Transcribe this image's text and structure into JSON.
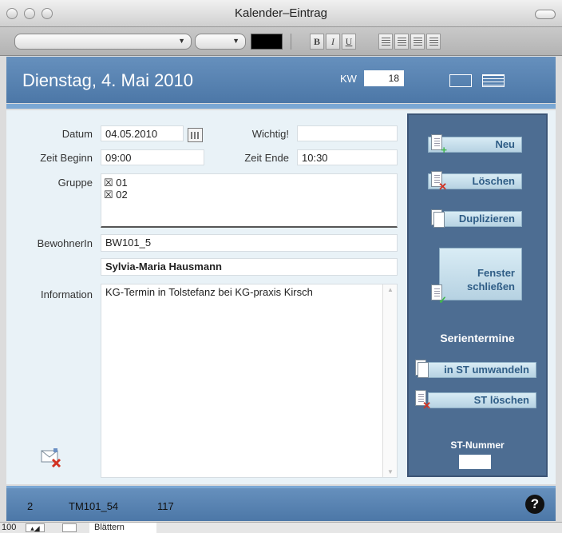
{
  "window": {
    "title": "Kalender–Eintrag"
  },
  "toolbar": {
    "bold_label": "B",
    "italic_label": "I",
    "underline_label": "U",
    "text_color": "#000000"
  },
  "header": {
    "date_title": "Dienstag, 4. Mai 2010",
    "kw_label": "KW",
    "kw_value": "18"
  },
  "form": {
    "datum_label": "Datum",
    "datum_value": "04.05.2010",
    "wichtig_label": "Wichtig!",
    "wichtig_value": "",
    "zeit_beginn_label": "Zeit Beginn",
    "zeit_beginn_value": "09:00",
    "zeit_ende_label": "Zeit Ende",
    "zeit_ende_value": "10:30",
    "gruppe_label": "Gruppe",
    "gruppe_items": [
      {
        "mark": "☒",
        "label": "01"
      },
      {
        "mark": "☒",
        "label": "02"
      }
    ],
    "bewohnerin_label": "BewohnerIn",
    "bewohnerin_id": "BW101_5",
    "bewohnerin_name": "Sylvia-Maria Hausmann",
    "information_label": "Information",
    "information_value": "KG-Termin in Tolstefanz bei KG-praxis Kirsch"
  },
  "side_panel": {
    "neu_label": "Neu",
    "loeschen_label": "Löschen",
    "duplizieren_label": "Duplizieren",
    "fenster_line1": "Fenster",
    "fenster_line2": "schließen",
    "serien_heading": "Serientermine",
    "in_st_label": "in ST umwandeln",
    "st_loeschen_label": "ST löschen",
    "st_nummer_label": "ST-Nummer",
    "st_nummer_value": ""
  },
  "footer": {
    "value1": "2",
    "value2": "TM101_54",
    "value3": "117",
    "help_label": "?"
  },
  "statusbar": {
    "zoom": "100",
    "mode_label": "Blättern"
  },
  "colors": {
    "header_blue": "#5b85b4",
    "panel_blue": "#4d6d92",
    "button_light": "#c8e0ee",
    "button_text": "#2f5d86",
    "plus_green": "#3fb84a",
    "cross_red": "#d23222"
  }
}
